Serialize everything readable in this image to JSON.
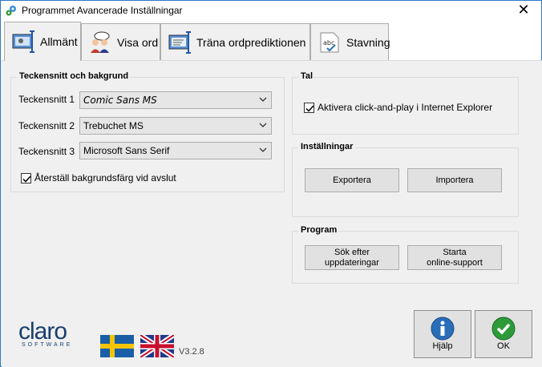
{
  "window": {
    "title": "Programmet Avancerade Inställningar",
    "close_glyph": "✕"
  },
  "tabs": [
    {
      "label": "Allmänt",
      "icon": "monitor-settings-icon",
      "active": true
    },
    {
      "label": "Visa ord",
      "icon": "people-speech-icon",
      "active": false
    },
    {
      "label": "Träna ordprediktionen",
      "icon": "monitor-training-icon",
      "active": false
    },
    {
      "label": "Stavning",
      "icon": "spelling-abc-icon",
      "active": false
    }
  ],
  "fonts_group": {
    "title": "Teckensnitt och bakgrund",
    "rows": [
      {
        "label": "Teckensnitt 1",
        "value": "Comic Sans MS"
      },
      {
        "label": "Teckensnitt 2",
        "value": "Trebuchet MS"
      },
      {
        "label": "Teckensnitt 3",
        "value": "Microsoft Sans Serif"
      }
    ],
    "reset_checkbox": {
      "label": "Återställ bakgrundsfärg vid avslut",
      "checked": true
    }
  },
  "speech_group": {
    "title": "Tal",
    "checkbox": {
      "label": "Aktivera click-and-play i Internet Explorer",
      "checked": true
    }
  },
  "settings_group": {
    "title": "Inställningar",
    "export_label": "Exportera",
    "import_label": "Importera"
  },
  "program_group": {
    "title": "Program",
    "update_label_1": "Sök efter",
    "update_label_2": "uppdateringar",
    "support_label_1": "Starta",
    "support_label_2": "online-support"
  },
  "footer": {
    "logo_main": "claro",
    "logo_sub": "SOFTWARE",
    "version": "V3.2.8",
    "help_label": "Hjälp",
    "ok_label": "OK"
  },
  "colors": {
    "accent": "#2b79c8",
    "ok_green": "#2e9b3a",
    "help_blue": "#2a6db8"
  }
}
